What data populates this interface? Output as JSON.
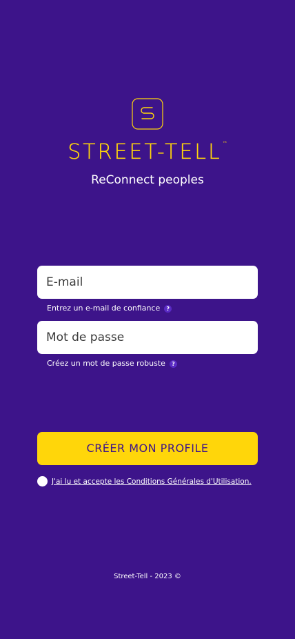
{
  "brand": {
    "name": "STREET-TELL",
    "tm": "™",
    "tagline": "ReConnect peoples",
    "accent_color": "#ffd60a",
    "background_color": "#3d148a",
    "logo_icon": "s-badge-icon"
  },
  "form": {
    "email": {
      "placeholder": "E-mail",
      "value": "",
      "hint": "Entrez un e-mail de confiance"
    },
    "password": {
      "placeholder": "Mot de passe",
      "value": "",
      "hint": "Créez un mot de passe robuste"
    },
    "help_glyph": "?",
    "submit_label": "CRÉER MON PROFILE",
    "terms_label": "J'ai lu et accepte les Conditions Générales d'Utilisation.",
    "terms_checked": false
  },
  "footer": {
    "text": "Street-Tell - 2023 ©"
  }
}
